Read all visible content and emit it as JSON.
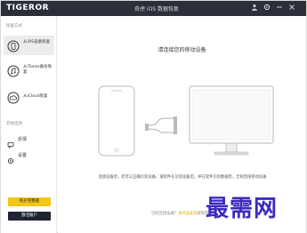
{
  "app": {
    "logo": "TIGEROR",
    "title": "奇虎 iOS 数据恢复"
  },
  "sidebar": {
    "section1_label": "恢复方式",
    "items": [
      {
        "label": "从iOS设备恢复",
        "icon": "phone-icon",
        "active": true
      },
      {
        "label": "从iTunes备份恢复",
        "icon": "itunes-icon",
        "active": false
      },
      {
        "label": "从iCloud恢复",
        "icon": "cloud-icon",
        "active": false
      }
    ],
    "section2_label": "其他选项",
    "feedback_label": "反馈",
    "settings_label": "设置",
    "buy_button": "购买完整版",
    "register_button": "激活账户"
  },
  "main": {
    "heading": "请连接您的移动设备",
    "description": "连接设备后，若可以正确识别设备，请软件在识别设备后，并在软件识别数据后，全程连接移动设备",
    "footer_prefix": "已经连接设备？",
    "footer_link": "请点击此处",
    "footer_suffix": "获取帮助"
  },
  "watermark": "最需网",
  "colors": {
    "titlebar": "#2b2f3a",
    "accent_yellow": "#f5c518",
    "dark_button": "#1f2433",
    "watermark": "#3b2bbd"
  }
}
